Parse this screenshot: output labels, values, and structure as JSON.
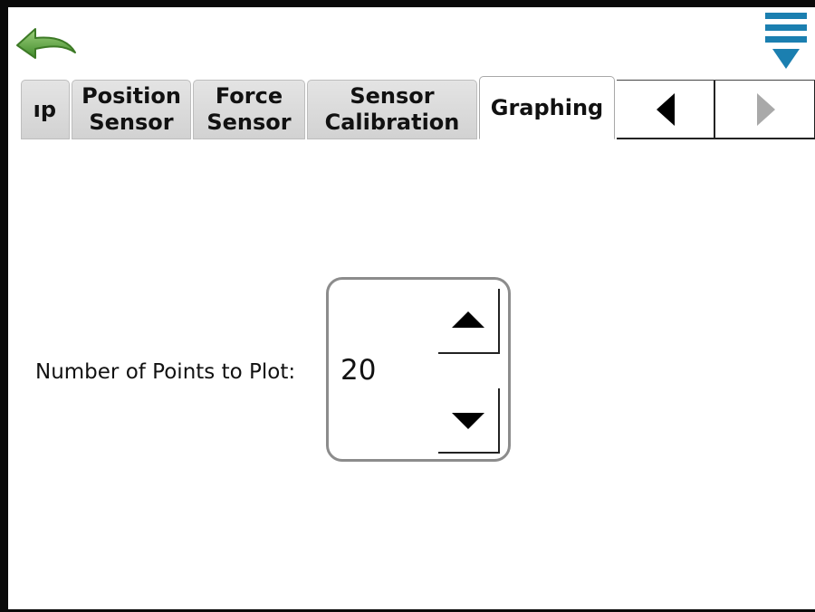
{
  "toolbar": {
    "back_icon": "back-arrow-icon",
    "back_color": "#5aa83a",
    "menu_icon": "menu-triangle-icon",
    "menu_color": "#1b7fb0"
  },
  "tabs": [
    {
      "label": "ıp",
      "state": "partial"
    },
    {
      "label": "Position\nSensor",
      "state": "inactive"
    },
    {
      "label": "Force\nSensor",
      "state": "inactive"
    },
    {
      "label": "Sensor\nCalibration",
      "state": "inactive"
    },
    {
      "label": "Graphing",
      "state": "active"
    }
  ],
  "tab_nav": {
    "prev_icon": "triangle-left-icon",
    "prev_enabled": true,
    "next_icon": "triangle-right-icon",
    "next_enabled": false
  },
  "points_setting": {
    "label": "Number of Points to Plot:",
    "value": "20",
    "increment_icon": "triangle-up-icon",
    "decrement_icon": "triangle-down-icon"
  }
}
